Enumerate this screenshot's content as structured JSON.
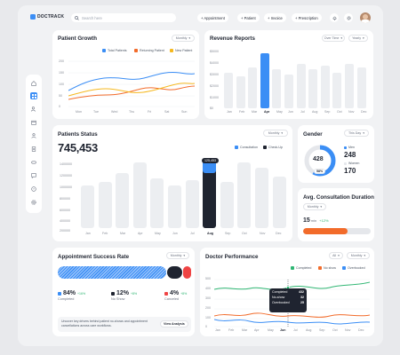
{
  "app": {
    "name": "DOCTRACK"
  },
  "header": {
    "search_placeholder": "Search here",
    "actions": [
      {
        "label": "+ Appointment"
      },
      {
        "label": "+ Patient"
      },
      {
        "label": "+ Invoice"
      },
      {
        "label": "+ Prescription"
      }
    ]
  },
  "sidebar": {
    "items": [
      "home-icon",
      "grid-icon",
      "users-icon",
      "calendar-icon",
      "user-icon",
      "document-icon",
      "pill-icon",
      "chat-icon",
      "help-icon",
      "settings-icon"
    ]
  },
  "patient_growth": {
    "title": "Patient Growth",
    "filter": "Monthly",
    "legend": [
      "Total Patients",
      "Returning Patient",
      "New Patient"
    ],
    "y_ticks": [
      "200",
      "150",
      "100",
      "50",
      "0"
    ],
    "x_ticks": [
      "Mon",
      "Tue",
      "Wed",
      "Thu",
      "Fri",
      "Sat",
      "Sun"
    ]
  },
  "revenue": {
    "title": "Revenue Reports",
    "filter1": "Over Time",
    "filter2": "Yearly",
    "y_ticks": [
      "$5000",
      "$4000",
      "$3000",
      "$2000",
      "$1000",
      "$0"
    ],
    "x_ticks": [
      "Jan",
      "Feb",
      "Mar",
      "Apr",
      "May",
      "Jun",
      "Jul",
      "Aug",
      "Sep",
      "Oct",
      "Nov",
      "Dec"
    ]
  },
  "patients_status": {
    "title": "Patients Status",
    "filter": "Monthly",
    "total": "745,453",
    "legend": [
      "Consultation",
      "Check-Up"
    ],
    "tooltip_value": "125,453",
    "y_ticks": [
      "1400000",
      "1200000",
      "1000000",
      "800000",
      "600000",
      "400000",
      "200000",
      "0"
    ],
    "x_ticks": [
      "Jan",
      "Feb",
      "Mar",
      "Apr",
      "May",
      "Jun",
      "Jul",
      "Aug",
      "Sep",
      "Oct",
      "Nov",
      "Dec"
    ]
  },
  "gender": {
    "title": "Gender",
    "filter": "This Day",
    "total": "428",
    "percent": "58%",
    "men_label": "Men",
    "men_value": "248",
    "women_label": "Women",
    "women_value": "170",
    "men_share": 0.58
  },
  "consult": {
    "title": "Avg. Consultation Duration",
    "filter": "Monthly",
    "value": "15",
    "unit": "min",
    "change": "+12%"
  },
  "success": {
    "title": "Appointment Success Rate",
    "filter": "Monthly",
    "stats": [
      {
        "value": "84%",
        "change": "+16%",
        "label": "Completed"
      },
      {
        "value": "12%",
        "change": "+8%",
        "label": "No Show"
      },
      {
        "value": "4%",
        "change": "+8%",
        "label": "Canceled"
      }
    ],
    "note": "Uncover key drivers behind patient no-shows and appointment cancellations across care workflows.",
    "cta": "View Analysis"
  },
  "doctor": {
    "title": "Doctor Performance",
    "filter1": "All",
    "filter2": "Monthly",
    "legend": [
      "Completed",
      "No show",
      "Overbooked"
    ],
    "y_ticks": [
      "500",
      "400",
      "300",
      "200",
      "100",
      "0"
    ],
    "x_ticks": [
      "Jan",
      "Feb",
      "Mar",
      "Apr",
      "May",
      "Jun",
      "Jul",
      "Aug",
      "Sep",
      "Oct",
      "Nov",
      "Dec"
    ],
    "tooltip": [
      {
        "label": "Completed",
        "value": "432"
      },
      {
        "label": "No-show",
        "value": "32"
      },
      {
        "label": "Overbooked",
        "value": "25"
      }
    ]
  },
  "colors": {
    "blue": "#3b8ef5",
    "orange": "#f26b2a",
    "yellow": "#f5b81f",
    "green": "#2fb673",
    "red": "#ef4444",
    "dark": "#1f2430"
  }
}
